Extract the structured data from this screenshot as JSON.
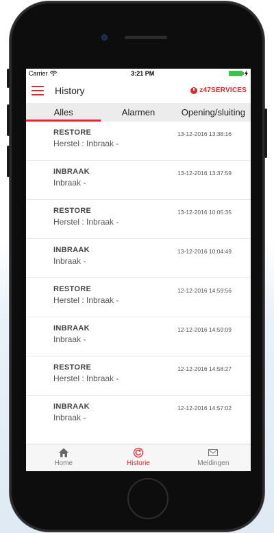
{
  "statusbar": {
    "carrier": "Carrier",
    "time": "3:21 PM"
  },
  "header": {
    "title": "History",
    "brand": "z47SERVICES"
  },
  "tabs": [
    {
      "label": "Alles",
      "active": true
    },
    {
      "label": "Alarmen",
      "active": false
    },
    {
      "label": "Opening/sluiting",
      "active": false
    }
  ],
  "events": [
    {
      "type": "RESTORE",
      "desc": "Herstel : Inbraak -",
      "time": "13-12-2016 13:38:16"
    },
    {
      "type": "INBRAAK",
      "desc": "Inbraak -",
      "time": "13-12-2016 13:37:59"
    },
    {
      "type": "RESTORE",
      "desc": "Herstel : Inbraak -",
      "time": "13-12-2016 10:05:35"
    },
    {
      "type": "INBRAAK",
      "desc": "Inbraak -",
      "time": "13-12-2016 10:04:49"
    },
    {
      "type": "RESTORE",
      "desc": "Herstel : Inbraak -",
      "time": "12-12-2016 14:59:56"
    },
    {
      "type": "INBRAAK",
      "desc": "Inbraak -",
      "time": "12-12-2016 14:59:09"
    },
    {
      "type": "RESTORE",
      "desc": "Herstel : Inbraak -",
      "time": "12-12-2016 14:58:27"
    },
    {
      "type": "INBRAAK",
      "desc": "Inbraak -",
      "time": "12-12-2016 14:57:02"
    }
  ],
  "nav": [
    {
      "label": "Home",
      "icon": "home-icon",
      "active": false
    },
    {
      "label": "Historie",
      "icon": "history-icon",
      "active": true
    },
    {
      "label": "Meldingen",
      "icon": "envelope-icon",
      "active": false
    }
  ],
  "colors": {
    "accent": "#e2262b",
    "battery": "#3bc44b"
  }
}
